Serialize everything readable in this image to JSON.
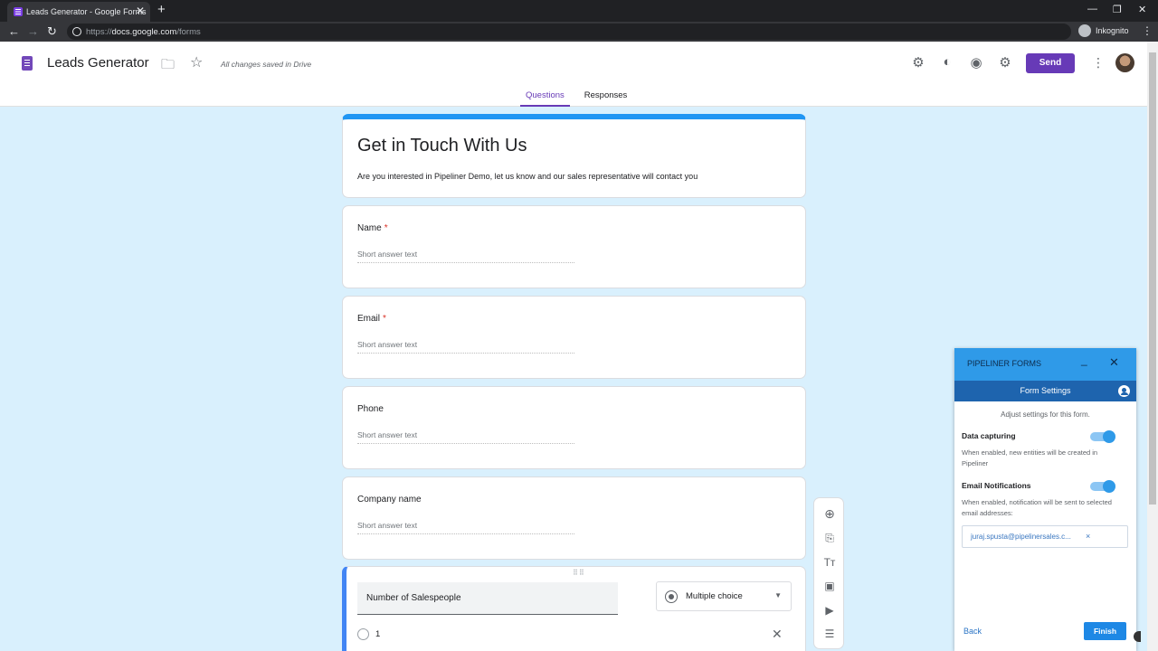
{
  "browser": {
    "tab_title": "Leads Generator - Google Forms",
    "tab_close": "✕",
    "new_tab": "+",
    "url_prefix": "https://",
    "url_domain": "docs.google.com",
    "url_path": "/forms",
    "incognito_label": "Inkognito",
    "minimize": "—",
    "restore": "❐",
    "close": "✕",
    "back": "←",
    "forward": "→",
    "reload": "↻",
    "menu": "⋮"
  },
  "header": {
    "doc_title": "Leads Generator",
    "saved_status": "All changes saved in Drive",
    "send_label": "Send",
    "folder_icon": "🗀",
    "star_icon": "☆",
    "addon_icon": "⚙",
    "palette_icon": "◐",
    "preview_icon": "◉",
    "settings_icon": "⚙",
    "more_icon": "⋮"
  },
  "form_tabs": [
    {
      "label": "Questions",
      "active": true
    },
    {
      "label": "Responses",
      "active": false
    }
  ],
  "form": {
    "title": "Get in Touch With Us",
    "description": "Are you interested in Pipeliner Demo, let us know and our sales representative will contact you",
    "questions": [
      {
        "label": "Name",
        "required": "*",
        "placeholder": "Short answer text"
      },
      {
        "label": "Email",
        "required": "*",
        "placeholder": "Short answer text"
      },
      {
        "label": "Phone",
        "required": "",
        "placeholder": "Short answer text"
      },
      {
        "label": "Company name",
        "required": "",
        "placeholder": "Short answer text"
      }
    ],
    "active_question": {
      "drag_handle": "⠿⠿",
      "title": "Number of Salespeople",
      "type": "Multiple choice",
      "caret": "▼",
      "option_1": "1",
      "remove": "✕"
    }
  },
  "side_toolbar": {
    "add": "⊕",
    "import": "⎘",
    "title": "Tт",
    "image": "▣",
    "video": "▶",
    "section": "☰"
  },
  "panel": {
    "title": "PIPELINER FORMS",
    "minimize": "_",
    "close": "✕",
    "subtitle": "Form Settings",
    "hint": "Adjust settings for this form.",
    "data_capturing_label": "Data capturing",
    "data_capturing_desc": "When enabled, new entities will be created in Pipeliner",
    "data_capturing_on": true,
    "email_notif_label": "Email Notifications",
    "email_notif_desc": "When enabled, notification will be sent to selected email addresses:",
    "email_notif_on": true,
    "email_chip": "juraj.spusta@pipelinersales.c...",
    "chip_remove": "×",
    "back_label": "Back",
    "finish_label": "Finish"
  },
  "colors": {
    "accent": "#673ab7",
    "form_bg": "#d9f0fd",
    "form_header_bar": "#2196f3",
    "panel_header": "#2f9ae8",
    "panel_subheader": "#1e64ae"
  }
}
